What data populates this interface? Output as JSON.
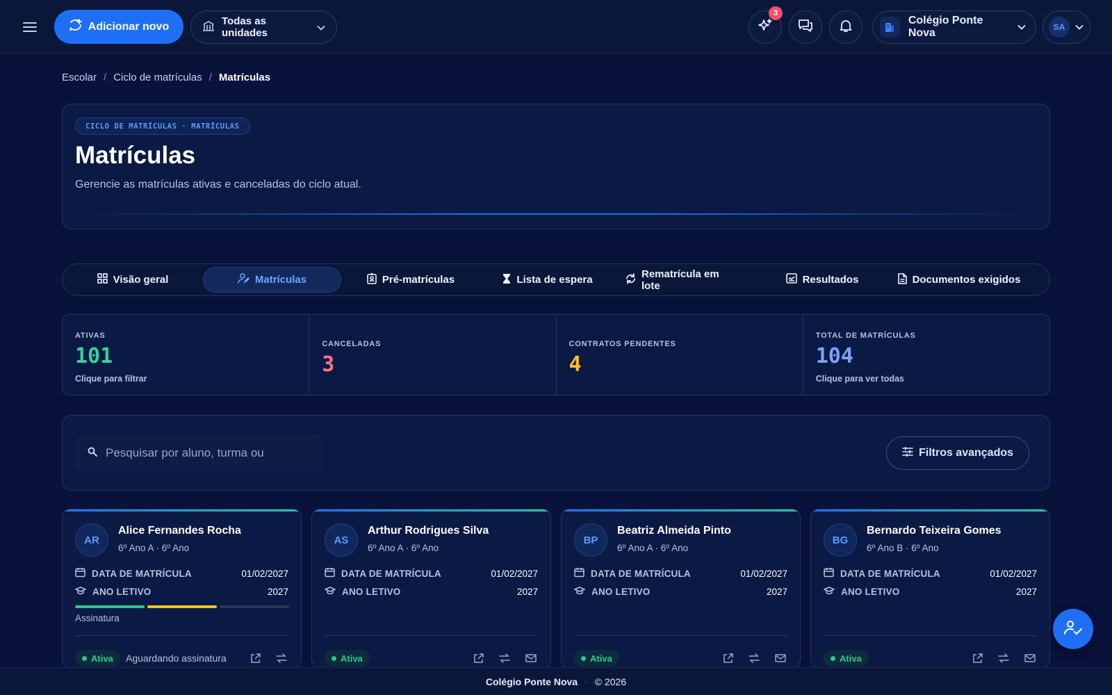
{
  "header": {
    "add_new_label": "Adicionar novo",
    "units_label": "Todas as unidades",
    "notifications_badge": "3",
    "school_name": "Colégio Ponte Nova",
    "user_initials": "SA"
  },
  "breadcrumb": {
    "items": [
      "Escolar",
      "Ciclo de matrículas"
    ],
    "current": "Matrículas",
    "separator": "/"
  },
  "hero": {
    "tag": "CICLO DE MATRÍCULAS · MATRÍCULAS",
    "title": "Matrículas",
    "subtitle": "Gerencie as matrículas ativas e canceladas do ciclo atual."
  },
  "tabs": [
    {
      "label": "Visão geral",
      "icon": "grid-icon"
    },
    {
      "label": "Matrículas",
      "icon": "user-edit-icon",
      "active": true
    },
    {
      "label": "Pré-matrículas",
      "icon": "id-badge-icon"
    },
    {
      "label": "Lista de espera",
      "icon": "hourglass-icon"
    },
    {
      "label": "Rematrícula em lote",
      "icon": "refresh-icon"
    },
    {
      "label": "Resultados",
      "icon": "report-icon"
    },
    {
      "label": "Documentos exigidos",
      "icon": "document-icon"
    }
  ],
  "stats": [
    {
      "label": "ATIVAS",
      "value": "101",
      "hint": "Clique para filtrar",
      "color": "#34d399"
    },
    {
      "label": "CANCELADAS",
      "value": "3",
      "hint": "",
      "color": "#f87189"
    },
    {
      "label": "CONTRATOS PENDENTES",
      "value": "4",
      "hint": "",
      "color": "#fbbf24"
    },
    {
      "label": "TOTAL DE MATRÍCULAS",
      "value": "104",
      "hint": "Clique para ver todas",
      "color": "#7aa2f7"
    }
  ],
  "search": {
    "placeholder": "Pesquisar por aluno, turma ou",
    "filters_label": "Filtros avançados"
  },
  "cards": [
    {
      "initials": "AR",
      "name": "Alice Fernandes Rocha",
      "class": "6º Ano A · 6º Ano",
      "date_label": "DATA DE MATRÍCULA",
      "date": "01/02/2027",
      "year_label": "ANO LETIVO",
      "year": "2027",
      "progress_label": "Assinatura",
      "status": "Ativa",
      "note": "Aguardando assinatura"
    },
    {
      "initials": "AS",
      "name": "Arthur Rodrigues Silva",
      "class": "6º Ano A · 6º Ano",
      "date_label": "DATA DE MATRÍCULA",
      "date": "01/02/2027",
      "year_label": "ANO LETIVO",
      "year": "2027",
      "status": "Ativa"
    },
    {
      "initials": "BP",
      "name": "Beatriz Almeida Pinto",
      "class": "6º Ano A · 6º Ano",
      "date_label": "DATA DE MATRÍCULA",
      "date": "01/02/2027",
      "year_label": "ANO LETIVO",
      "year": "2027",
      "status": "Ativa"
    },
    {
      "initials": "BG",
      "name": "Bernardo Teixeira Gomes",
      "class": "6º Ano B · 6º Ano",
      "date_label": "DATA DE MATRÍCULA",
      "date": "01/02/2027",
      "year_label": "ANO LETIVO",
      "year": "2027",
      "status": "Ativa"
    }
  ],
  "footer": {
    "school": "Colégio Ponte Nova",
    "copyright": "© 2026"
  },
  "colors": {
    "accent": "#1f6ff5",
    "background": "#08123a",
    "success": "#2ec98a",
    "warning": "#fbbf24",
    "danger": "#f87189"
  }
}
